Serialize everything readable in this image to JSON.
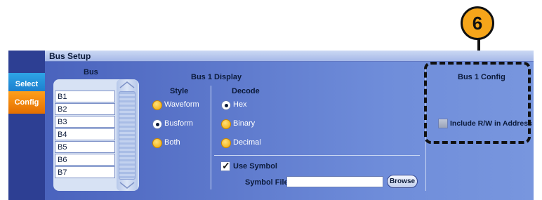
{
  "side_tabs": {
    "select": "Select",
    "config": "Config"
  },
  "panel": {
    "title": "Bus Setup"
  },
  "bus_list": {
    "header": "Bus",
    "items": [
      "B1",
      "B2",
      "B3",
      "B4",
      "B5",
      "B6",
      "B7"
    ],
    "selected": "B1"
  },
  "display": {
    "title": "Bus 1 Display",
    "style": {
      "label": "Style",
      "options": [
        "Waveform",
        "Busform",
        "Both"
      ],
      "selected": "Busform"
    },
    "decode": {
      "label": "Decode",
      "options": [
        "Hex",
        "Binary",
        "Decimal"
      ],
      "selected": "Hex"
    },
    "use_symbol": {
      "label": "Use Symbol",
      "checked": true
    },
    "symbol_file": {
      "label": "Symbol File",
      "value": "",
      "browse_label": "Browse"
    }
  },
  "config": {
    "title": "Bus 1 Config",
    "include_rw": {
      "label": "Include R/W in Address",
      "checked": false
    }
  },
  "callout": {
    "number": "6"
  },
  "colors": {
    "tab_select": "#1f8ad8",
    "tab_config": "#f28a0c",
    "panel": "#5b78cc",
    "callout": "#f6a51a"
  }
}
